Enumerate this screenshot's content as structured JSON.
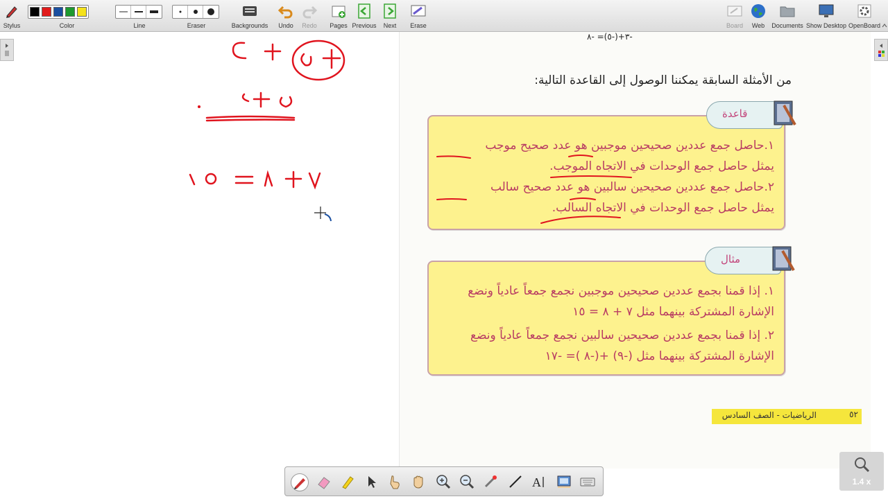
{
  "toolbar": {
    "stylus": "Stylus",
    "color": "Color",
    "line": "Line",
    "eraser": "Eraser",
    "backgrounds": "Backgrounds",
    "undo": "Undo",
    "redo": "Redo",
    "pages": "Pages",
    "previous": "Previous",
    "next": "Next",
    "erase": "Erase",
    "board": "Board",
    "web": "Web",
    "documents": "Documents",
    "show_desktop": "Show Desktop",
    "openboard": "OpenBoard",
    "colors": [
      "#000000",
      "#e11b1b",
      "#1a4fa0",
      "#1e9a2e",
      "#f5e21a"
    ]
  },
  "page": {
    "top_equation": "-٣+(-٥)= -٨",
    "intro": "من الأمثلة السابقة يمكننا الوصول إلى القاعدة التالية:",
    "rule_box": {
      "tab": "قاعدة",
      "lines": [
        "١.حاصل جمع عددين صحيحين موجبين هو عدد صحيح موجب",
        "يمثل حاصل جمع الوحدات في الاتجاه الموجب.",
        "٢.حاصل جمع عددين صحيحين سالبين هو عدد صحيح سالب",
        "يمثل حاصل جمع الوحدات في الاتجاه السالب."
      ]
    },
    "example_box": {
      "tab": "مثال",
      "lines": [
        "١. إذا قمنا بجمع عددين صحيحين موجبين نجمع جمعاً عادياً ونضع",
        "الإشارة المشتركة بينهما مثل ٧ + ٨ = ١٥",
        "٢. إذا قمنا بجمع عددين صحيحين سالبين نجمع جمعاً عادياً ونضع",
        "الإشارة المشتركة بينهما مثل (-٩) +(-٨ )= -١٧"
      ]
    },
    "footer": "الرياضيات - الصف السادس",
    "page_number": "٥٢"
  },
  "zoom": {
    "level": "1.4 x"
  },
  "accent": {
    "ink_red": "#e0141e",
    "arabic_pink": "#b83b63",
    "box_yellow": "#fdf28e"
  }
}
